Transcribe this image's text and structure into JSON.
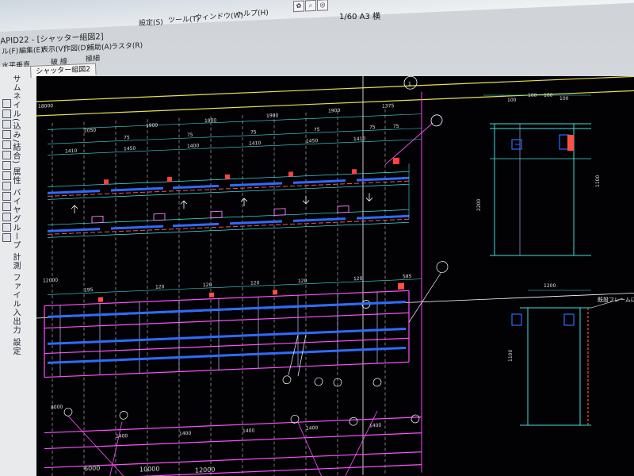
{
  "window": {
    "title": "APID22 - [シャッター組図2]",
    "scale": "1/60 A3 横"
  },
  "menu": {
    "items": [
      {
        "label": "設定(S)"
      },
      {
        "label": "ツール(T)"
      },
      {
        "label": "ウィンドウ(W)"
      },
      {
        "label": "ヘルプ(H)"
      }
    ],
    "second_row": [
      {
        "label": "ル(F)"
      },
      {
        "label": "編集(E)"
      },
      {
        "label": "表示(V)"
      },
      {
        "label": "作図(D)"
      },
      {
        "label": "補助(A)"
      },
      {
        "label": "ラスタ(R)"
      }
    ]
  },
  "toolbar2": {
    "left_label": "水平垂直",
    "line_type": "破 線",
    "line_width": "極細"
  },
  "left_panel": {
    "vertical_caption": "サムネイル(込み/結合) 属性 バイヤグループ 計測 ファイル入出力 設定"
  },
  "document_tab": {
    "label": "シャッター組図2"
  },
  "drawing": {
    "top_dims": [
      "2050",
      "1900",
      "1900",
      "1900",
      "1900",
      "1375"
    ],
    "mid_dims": [
      "1410",
      "1450",
      "1400",
      "1410",
      "1450",
      "1410"
    ],
    "small_dims": [
      "75",
      "75",
      "75",
      "75",
      "75",
      "75"
    ],
    "lower_dims": [
      "195",
      "120",
      "120",
      "120",
      "120",
      "120",
      "585"
    ],
    "bottom_dims": [
      "1400",
      "1400",
      "1400",
      "1400",
      "1400"
    ],
    "left_level_labels": [
      "18000",
      "12000",
      "8000"
    ],
    "bottom_levels": [
      "6000",
      "10000",
      "12000"
    ],
    "right_top_dims": [
      "100",
      "100",
      "100",
      "100"
    ],
    "right_side_dims": [
      "2200",
      "1100",
      "1100"
    ],
    "right_lower_dim": "1200",
    "annotation_jp": "既設フレームに溶着"
  }
}
